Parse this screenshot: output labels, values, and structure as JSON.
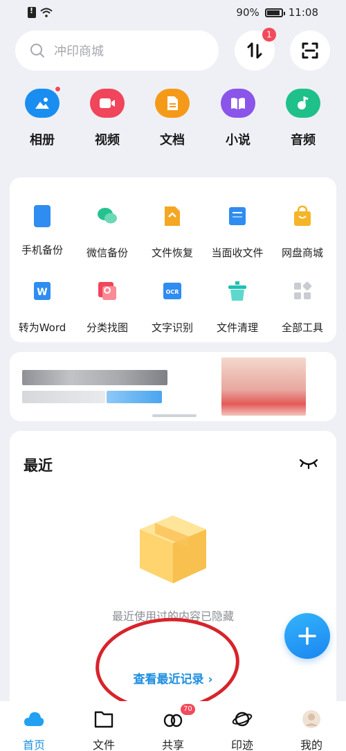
{
  "status_bar": {
    "battery": "90%",
    "time": "11:08"
  },
  "search": {
    "placeholder": "冲印商城"
  },
  "transfer": {
    "badge": "1"
  },
  "top_icons": [
    {
      "label": "相册",
      "color": "#1a8ef0",
      "icon": "photo-album-icon",
      "dot": true
    },
    {
      "label": "视频",
      "color": "#f0455a",
      "icon": "video-icon"
    },
    {
      "label": "文档",
      "color": "#f59a18",
      "icon": "document-icon"
    },
    {
      "label": "小说",
      "color": "#8a55e8",
      "icon": "book-icon"
    },
    {
      "label": "音频",
      "color": "#1fc08a",
      "icon": "music-icon"
    }
  ],
  "tools": [
    {
      "label": "手机备份",
      "icon": "phone-backup-icon",
      "color": "#2f8cf0"
    },
    {
      "label": "微信备份",
      "icon": "wechat-backup-icon",
      "color": "#25c28f"
    },
    {
      "label": "文件恢复",
      "icon": "file-restore-icon",
      "color": "#f5a623"
    },
    {
      "label": "当面收文件",
      "icon": "receive-file-icon",
      "color": "#2f8cf0"
    },
    {
      "label": "网盘商城",
      "icon": "shop-bag-icon",
      "color": "#f5b526"
    },
    {
      "label": "转为Word",
      "icon": "word-convert-icon",
      "color": "#2f8cf0"
    },
    {
      "label": "分类找图",
      "icon": "image-search-icon",
      "color": "#f0455a"
    },
    {
      "label": "文字识别",
      "icon": "ocr-icon",
      "color": "#2f8cf0"
    },
    {
      "label": "文件清理",
      "icon": "clean-basket-icon",
      "color": "#1fc0b0"
    },
    {
      "label": "全部工具",
      "icon": "all-tools-icon",
      "color": "#c9ccd2"
    }
  ],
  "recent": {
    "title": "最近",
    "hidden_text": "最近使用过的内容已隐藏",
    "view_link": "查看最近记录 ›"
  },
  "bottom_nav": [
    {
      "label": "首页",
      "icon": "home-cloud-icon",
      "active": true
    },
    {
      "label": "文件",
      "icon": "folder-icon"
    },
    {
      "label": "共享",
      "icon": "share-icon",
      "badge": "70"
    },
    {
      "label": "印迹",
      "icon": "planet-icon"
    },
    {
      "label": "我的",
      "icon": "profile-avatar-icon"
    }
  ]
}
